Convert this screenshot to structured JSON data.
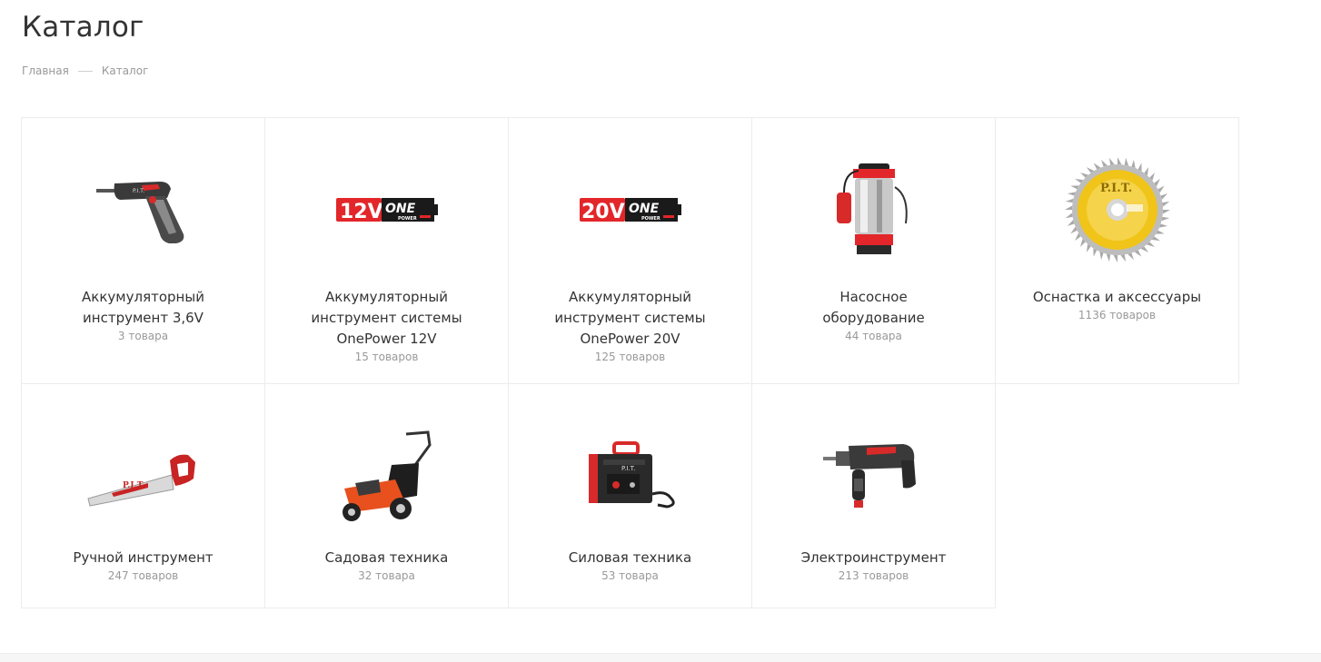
{
  "page": {
    "title": "Каталог"
  },
  "breadcrumb": {
    "home": "Главная",
    "current": "Каталог"
  },
  "colors": {
    "brand_red": "#e2262a",
    "text": "#333333",
    "muted": "#999999",
    "border": "#ececec"
  },
  "categories": [
    {
      "name": "Аккумуляторный инструмент 3,6V",
      "count": "3 товара",
      "icon": "cordless-screwdriver-icon"
    },
    {
      "name": "Аккумуляторный инструмент системы OnePower 12V",
      "count": "15 товаров",
      "icon": "onepower-12v-logo"
    },
    {
      "name": "Аккумуляторный инструмент системы OnePower 20V",
      "count": "125 товаров",
      "icon": "onepower-20v-logo"
    },
    {
      "name": "Насосное оборудование",
      "count": "44 товара",
      "icon": "water-pump-icon"
    },
    {
      "name": "Оснастка и аксессуары",
      "count": "1136 товаров",
      "icon": "saw-blade-icon"
    },
    {
      "name": "Ручной инструмент",
      "count": "247 товаров",
      "icon": "hand-saw-icon"
    },
    {
      "name": "Садовая техника",
      "count": "32 товара",
      "icon": "lawn-mower-icon"
    },
    {
      "name": "Силовая техника",
      "count": "53 товара",
      "icon": "welding-inverter-icon"
    },
    {
      "name": "Электроинструмент",
      "count": "213 товаров",
      "icon": "hammer-drill-icon"
    }
  ],
  "logos": {
    "v12": "12V",
    "v20": "20V",
    "one": "ONE",
    "power": "POWER",
    "pit": "P.I.T."
  }
}
